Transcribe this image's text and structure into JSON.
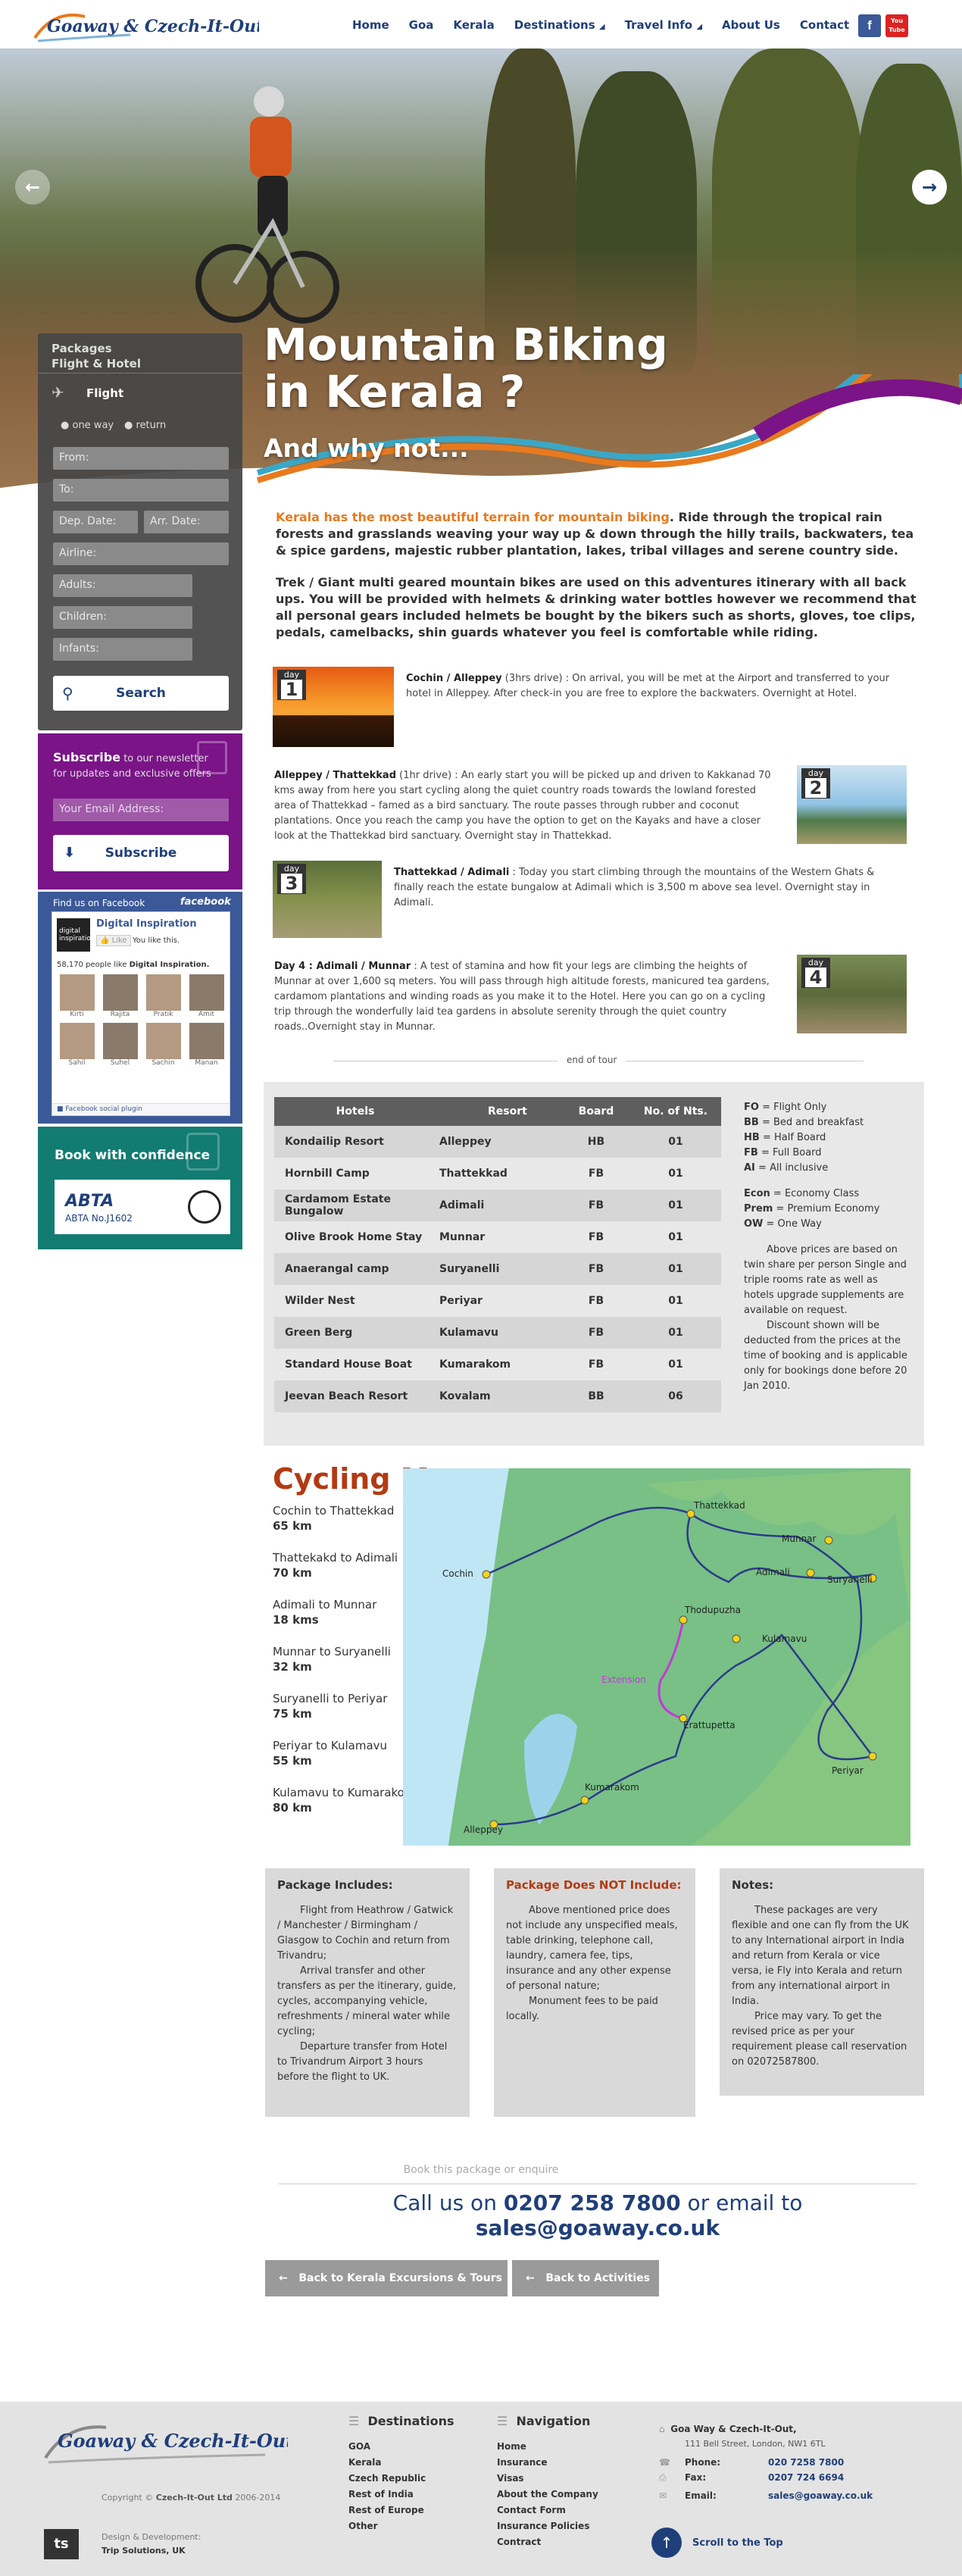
{
  "header": {
    "logo_text": "Goaway & Czech-It-Out",
    "nav": [
      "Home",
      "Goa",
      "Kerala",
      "Destinations",
      "Travel Info",
      "About Us",
      "Contact"
    ],
    "social": {
      "facebook": "f",
      "youtube": "You Tube"
    }
  },
  "hero": {
    "title_line1": "Mountain Biking",
    "title_line2": "in Kerala ?",
    "subtitle": "And why not..."
  },
  "booking": {
    "heading1": "Packages",
    "heading2": "Flight & Hotel",
    "flight_label": "Flight",
    "one_way": "one way",
    "return": "return",
    "from_placeholder": "From:",
    "to_placeholder": "To:",
    "dep_placeholder": "Dep. Date:",
    "arr_placeholder": "Arr. Date:",
    "airline_placeholder": "Airline:",
    "adults_placeholder": "Adults:",
    "children_placeholder": "Children:",
    "infants_placeholder": "Infants:",
    "search_label": "Search"
  },
  "subscribe": {
    "title": "Subscribe",
    "text1": " to our newsletter",
    "text2": "for updates and exclusive offers",
    "email_placeholder": "Your Email Address:",
    "button": "Subscribe"
  },
  "facebook": {
    "find_us": "Find us on Facebook",
    "brand": "facebook",
    "page_name": "Digital Inspiration",
    "page_thumb": "digital inspiration",
    "like": "Like",
    "you_like": "You like this.",
    "count_text": "58,170 people like",
    "count_name": "Digital Inspiration.",
    "people": [
      "Kirti",
      "Rajita",
      "Pratik",
      "Amit",
      "Sahil",
      "Suhel",
      "Sachin",
      "Manan"
    ],
    "plugin": "Facebook social plugin"
  },
  "abta": {
    "title": "Book with confidence",
    "logo": "ABTA",
    "number": "ABTA No.J1602"
  },
  "intro": {
    "highlight": "Kerala has the most beautiful terrain for mountain biking",
    "p1_rest": ". Ride through the tropical rain forests and grasslands weaving your way up & down through the hilly trails, backwaters, tea & spice gardens, majestic rubber plantation, lakes, tribal villages and serene country side.",
    "p2": "Trek / Giant multi geared mountain bikes are used on this adventures itinerary with all back ups. You will be provided with helmets & drinking water bottles however we recommend that all personal gears included helmets be bought by the bikers such as shorts, gloves, toe clips, pedals, camelbacks, shin guards whatever you feel is comfortable while riding."
  },
  "days": [
    {
      "label": "day",
      "num": "1",
      "title": "Cochin / Alleppey",
      "dur": " (3hrs drive) : On arrival, you will be met at the Airport and transferred to your hotel in Alleppey. After check-in you are free to explore the backwaters. Overnight at Hotel."
    },
    {
      "label": "day",
      "num": "2",
      "title": "Alleppey / Thattekkad",
      "dur": " (1hr drive) : An early start you will be picked up and driven to Kakkanad 70 kms away from here you start cycling along the quiet country roads towards the lowland forested area of Thattekkad – famed as a bird sanctuary. The route passes through rubber and coconut plantations. Once you reach the camp you have the option to get on the Kayaks and have a closer look at the Thattekkad bird sanctuary. Overnight stay in Thattekkad."
    },
    {
      "label": "day",
      "num": "3",
      "title": "Thattekkad / Adimali",
      "dur": " : Today you start climbing through the mountains of the Western Ghats & finally reach the estate bungalow at Adimali which is 3,500 m above sea level. Overnight stay in Adimali."
    },
    {
      "label": "day",
      "num": "4",
      "title": "Day 4 : Adimali / Munnar",
      "dur": " : A test of stamina and how fit your legs are climbing the heights of Munnar at over 1,600 sq meters. You will pass through high altitude forests, manicured tea gardens, cardamom plantations and winding roads as you make it to the Hotel. Here you can go on a cycling trip through the wonderfully laid tea gardens in absolute serenity through the quiet country roads..Overnight stay in Munnar."
    }
  ],
  "end_of_tour": "end of tour",
  "hotels": {
    "headers": [
      "Hotels",
      "Resort",
      "Board",
      "No. of Nts."
    ],
    "rows": [
      [
        "Kondailip Resort",
        "Alleppey",
        "HB",
        "01"
      ],
      [
        "Hornbill Camp",
        "Thattekkad",
        "FB",
        "01"
      ],
      [
        "Cardamom Estate Bungalow",
        "Adimali",
        "FB",
        "01"
      ],
      [
        "Olive Brook Home Stay",
        "Munnar",
        "FB",
        "01"
      ],
      [
        "Anaerangal camp",
        "Suryanelli",
        "FB",
        "01"
      ],
      [
        "Wilder Nest",
        "Periyar",
        "FB",
        "01"
      ],
      [
        "Green Berg",
        "Kulamavu",
        "FB",
        "01"
      ],
      [
        "Standard House Boat",
        "Kumarakom",
        "FB",
        "01"
      ],
      [
        "Jeevan Beach Resort",
        "Kovalam",
        "BB",
        "06"
      ]
    ],
    "legend": [
      [
        "FO",
        "= Flight Only"
      ],
      [
        "BB",
        "= Bed and breakfast"
      ],
      [
        "HB",
        "= Half Board"
      ],
      [
        "FB",
        "= Full Board"
      ],
      [
        "AI",
        "= All inclusive"
      ]
    ],
    "legend2": [
      [
        "Econ",
        "= Economy Class"
      ],
      [
        "Prem",
        "= Premium Economy"
      ],
      [
        "OW",
        "= One Way"
      ]
    ],
    "note1": "Above prices are based on twin share per person Single and triple rooms rate as well as hotels upgrade supplements are available on request.",
    "note2": "Discount shown will be deducted from the prices at the time of booking and is applicable only for bookings done before 20 Jan 2010."
  },
  "map": {
    "title": "Cycling Map",
    "routes": [
      [
        "Cochin to Thattekkad",
        "65 km"
      ],
      [
        "Thattekakd to Adimali",
        "70 km"
      ],
      [
        "Adimali to Munnar",
        "18 kms"
      ],
      [
        "Munnar to Suryanelli",
        "32 km"
      ],
      [
        "Suryanelli to Periyar",
        "75 km"
      ],
      [
        "Periyar to Kulamavu",
        "55 km"
      ],
      [
        "Kulamavu to Kumarakom",
        "80 km"
      ]
    ],
    "places": [
      "Thattekkad",
      "Munnar",
      "Adimali",
      "Suryanelli",
      "Cochin",
      "Thodupuzha",
      "Kulamavu",
      "Extension",
      "Erattupetta",
      "Kumarakom",
      "Periyar",
      "Alleppey"
    ]
  },
  "info": {
    "includes_title": "Package Includes:",
    "includes": [
      "Flight from Heathrow / Gatwick / Manchester / Birmingham / Glasgow to Cochin and return from Trivandru;",
      "Arrival transfer and other transfers as per the itinerary, guide, cycles, accompanying vehicle, refreshments / mineral water while cycling;",
      "Departure transfer from Hotel to Trivandrum Airport 3 hours before the flight to UK."
    ],
    "excludes_title": "Package Does NOT Include:",
    "excludes": [
      "Above mentioned price does not include any unspecified meals, table drinking, telephone call, laundry, camera fee, tips, insurance and any other expense of personal nature;",
      "Monument fees to be paid locally."
    ],
    "notes_title": "Notes:",
    "notes": [
      "These packages are very flexible and one can fly from the UK to any International airport in India and return from Kerala or vice versa, ie Fly into Kerala and return from any international airport in India.",
      "Price may vary. To get the revised price as per your requirement please call reservation on 02072587800."
    ]
  },
  "contact": {
    "book_text": "Book this package or enquire",
    "call_pre": "Call us on ",
    "phone": "0207 258 7800",
    "email_pre": " or email to ",
    "email": "sales@goaway.co.uk"
  },
  "back": {
    "kerala": "Back to Kerala Excursions & Tours",
    "activities": "Back to Activities"
  },
  "footer": {
    "copyright_pre": "Copyright © ",
    "copyright_co": "Czech-It-Out Ltd",
    "copyright_years": " 2006-2014",
    "design_label": "Design & Development:",
    "design_co": "Trip Solutions, UK",
    "destinations_title": "Destinations",
    "destinations": [
      "GOA",
      "Kerala",
      "Czech Republic",
      "Rest of India",
      "Rest of Europe",
      "Other"
    ],
    "navigation_title": "Navigation",
    "navigation": [
      "Home",
      "Insurance",
      "Visas",
      "About the Company",
      "Contact Form",
      "Insurance Policies",
      "Contract"
    ],
    "company": "Goa Way & Czech-It-Out,",
    "address": "111 Bell Street, London, NW1 6TL",
    "phone_label": "Phone:",
    "phone": "020 7258 7800",
    "fax_label": "Fax:",
    "fax": "0207 724 6694",
    "email_label": "Email:",
    "email": "sales@goaway.co.uk",
    "scroll_top": "Scroll to the Top"
  },
  "colors": {
    "navy": "#1f3f7a",
    "orange": "#e87a1e",
    "purple": "#7a1487",
    "teal": "#127c72",
    "facebook": "#3b5998",
    "map_title": "#b33a12"
  }
}
